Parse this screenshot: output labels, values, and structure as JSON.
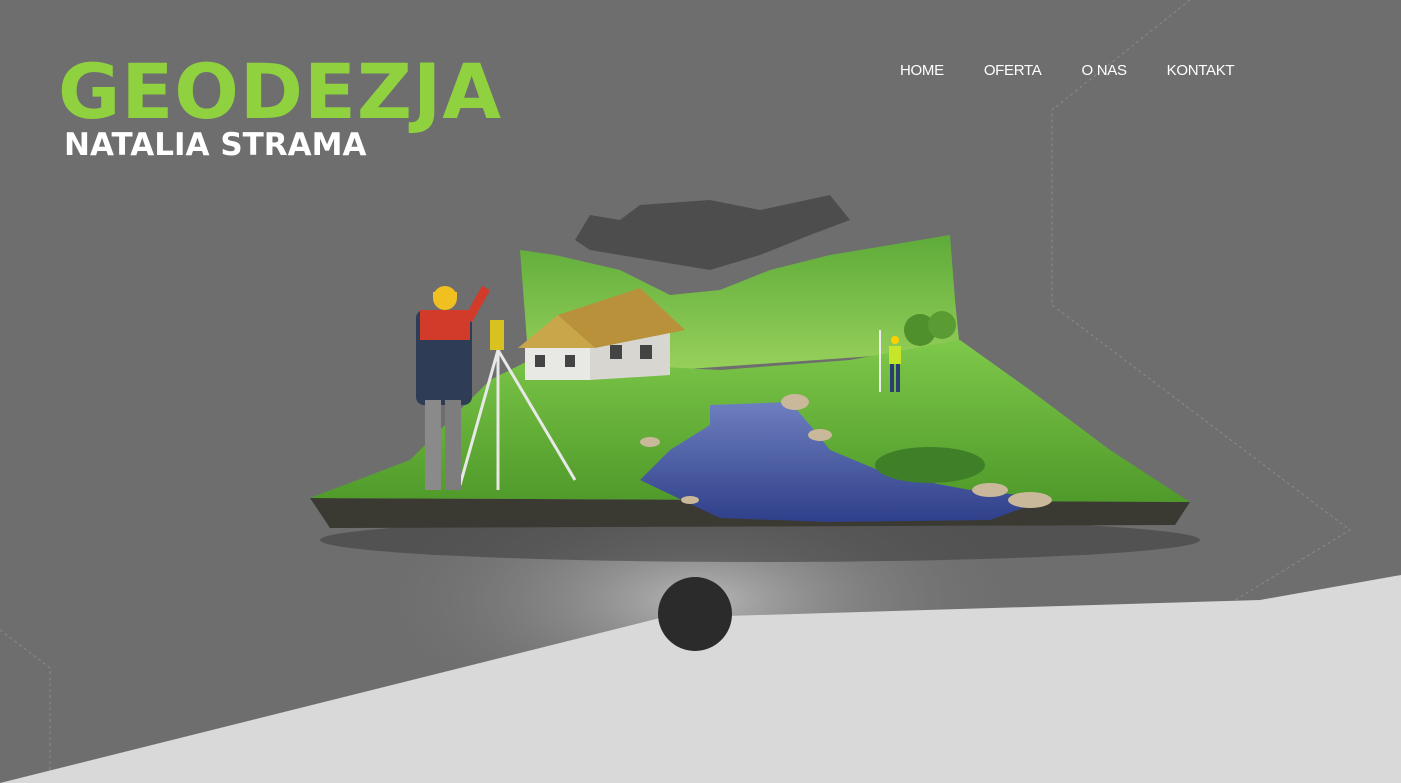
{
  "brand": {
    "title": "GEODEZJA",
    "subtitle": "NATALIA STRAMA"
  },
  "nav": {
    "items": [
      {
        "label": "HOME"
      },
      {
        "label": "OFERTA"
      },
      {
        "label": "O NAS"
      },
      {
        "label": "KONTAKT"
      }
    ]
  },
  "colors": {
    "background": "#6e6e6e",
    "accent_green": "#8fd13f",
    "lower_band": "#d9d9d9",
    "scroll_dot": "#2b2b2b"
  },
  "hero": {
    "illustration": "surveyor-landscape-diorama",
    "scroll_indicator_icon": "scroll-dot-icon"
  }
}
